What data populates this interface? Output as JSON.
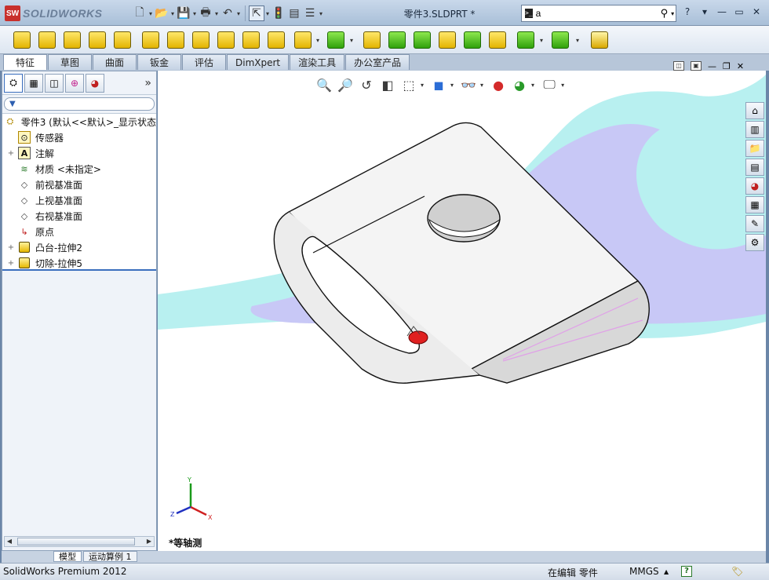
{
  "app": {
    "logo_mark": "SW",
    "logo_text": "SOLIDWORKS",
    "doc_title": "零件3.SLDPRT *"
  },
  "search": {
    "value": "a",
    "cmd_icon": ">_"
  },
  "titlebar": {
    "quick_access": [
      {
        "name": "new-document-icon",
        "glyph": "🗋"
      },
      {
        "name": "open-icon",
        "glyph": "📂"
      },
      {
        "name": "save-icon",
        "glyph": "💾"
      },
      {
        "name": "print-icon",
        "glyph": "🖶"
      },
      {
        "name": "undo-icon",
        "glyph": "↶"
      },
      {
        "name": "select-icon",
        "glyph": "⇱"
      },
      {
        "name": "rebuild-icon",
        "glyph": "🚦"
      },
      {
        "name": "file-properties-icon",
        "glyph": "▤"
      },
      {
        "name": "options-icon",
        "glyph": "☰"
      }
    ],
    "help_glyph": "?",
    "window_controls": [
      "▾",
      "—",
      "▭",
      "✕"
    ]
  },
  "tabs": [
    "特征",
    "草图",
    "曲面",
    "钣金",
    "评估",
    "DimXpert",
    "渲染工具",
    "办公室产品"
  ],
  "panel": {
    "tab_icons": [
      "feature-manager-icon",
      "property-manager-icon",
      "configuration-manager-icon",
      "dimxpert-manager-icon",
      "display-manager-icon"
    ],
    "more": "»",
    "filter_icon": "▼",
    "root": "零件3 (默认<<默认>_显示状态",
    "items": [
      {
        "label": "传感器",
        "icon": "⊙",
        "expand": ""
      },
      {
        "label": "注解",
        "icon": "A",
        "expand": "+"
      },
      {
        "label": "材质 <未指定>",
        "icon": "≋",
        "expand": ""
      },
      {
        "label": "前视基准面",
        "icon": "◇",
        "expand": ""
      },
      {
        "label": "上视基准面",
        "icon": "◇",
        "expand": ""
      },
      {
        "label": "右视基准面",
        "icon": "◇",
        "expand": ""
      },
      {
        "label": "原点",
        "icon": "↳",
        "expand": ""
      },
      {
        "label": "凸台-拉伸2",
        "icon": "box",
        "expand": "+"
      },
      {
        "label": "切除-拉伸5",
        "icon": "box",
        "expand": "+"
      }
    ]
  },
  "viewport": {
    "view_label": "*等轴测",
    "hud": [
      {
        "name": "zoom-to-fit-icon",
        "glyph": "🔍",
        "drop": false
      },
      {
        "name": "zoom-to-area-icon",
        "glyph": "🔎",
        "drop": false
      },
      {
        "name": "previous-view-icon",
        "glyph": "↺",
        "drop": false
      },
      {
        "name": "section-view-icon",
        "glyph": "◧",
        "drop": false
      },
      {
        "name": "view-orientation-icon",
        "glyph": "⬚",
        "drop": true
      },
      {
        "name": "display-style-icon",
        "glyph": "◼",
        "drop": true
      },
      {
        "name": "hide-show-items-icon",
        "glyph": "👓",
        "drop": true
      },
      {
        "name": "edit-appearance-icon",
        "glyph": "●",
        "drop": false
      },
      {
        "name": "apply-scene-icon",
        "glyph": "◕",
        "drop": true
      },
      {
        "name": "view-settings-icon",
        "glyph": "🖵",
        "drop": true
      }
    ],
    "task_pane": [
      "home-icon",
      "design-library-icon",
      "file-explorer-icon",
      "view-palette-icon",
      "appearances-icon",
      "custom-properties-icon",
      "solidworks-forum-icon",
      "toolbox-icon"
    ],
    "triad_labels": {
      "x": "X",
      "y": "Y",
      "z": "Z"
    }
  },
  "bottom_tabs": [
    "模型",
    "运动算例 1"
  ],
  "status": {
    "product": "SolidWorks Premium 2012",
    "mode": "在编辑 零件",
    "units": "MMGS",
    "units_drop": "▲",
    "help": "?"
  },
  "colors": {
    "background_purple": "#c7c8f4",
    "background_cyan": "#b9f2f2",
    "accent": "#3b6fbe"
  }
}
